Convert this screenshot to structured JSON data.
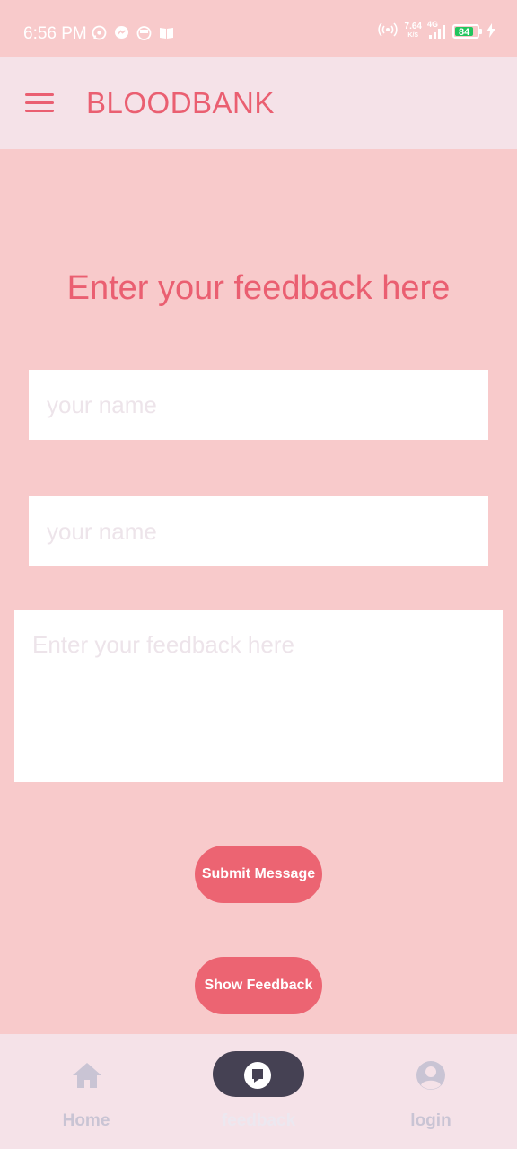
{
  "status_bar": {
    "time": "6:56 PM",
    "net_speed": "7.64",
    "net_speed_unit": "K/S",
    "network_type": "4G",
    "battery_level": "84",
    "icons": [
      "whatsapp-icon",
      "messenger-icon",
      "app-icon",
      "book-icon",
      "hotspot-icon",
      "signal-icon",
      "battery-icon",
      "charging-icon"
    ]
  },
  "app_bar": {
    "title": "BLOODBANK",
    "menu_icon": "hamburger-menu-icon"
  },
  "form": {
    "heading": "Enter your feedback here",
    "name_placeholder": "your name",
    "second_placeholder": "your name",
    "feedback_placeholder": "Enter your feedback here",
    "submit_label": "Submit Message",
    "show_label": "Show Feedback"
  },
  "bottom_nav": {
    "items": [
      {
        "label": "Home",
        "icon": "home-icon",
        "active": false
      },
      {
        "label": "feedback",
        "icon": "feedback-icon",
        "active": true
      },
      {
        "label": "login",
        "icon": "account-circle-icon",
        "active": false
      }
    ]
  },
  "colors": {
    "background": "#f8cacb",
    "accent": "#ea5f71",
    "bar_background": "#f5e2e8",
    "button": "#ec6472",
    "active_indicator": "#454153"
  }
}
